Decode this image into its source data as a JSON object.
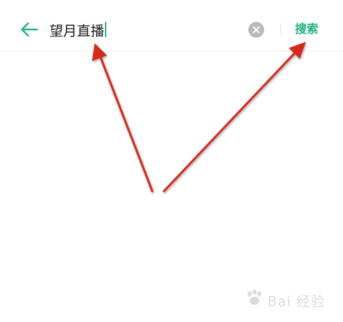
{
  "search_bar": {
    "back_icon": "arrow-left-icon",
    "query": "望月直播",
    "clear_icon": "close-circle-icon",
    "search_label": "搜索"
  },
  "watermark": {
    "logo_icon": "paw-logo-icon",
    "text": "Bai 经验"
  },
  "colors": {
    "accent": "#1fb27a",
    "arrow": "#d42a1f",
    "clear_bg": "#b9b9b9",
    "text": "#1a1a1a"
  }
}
